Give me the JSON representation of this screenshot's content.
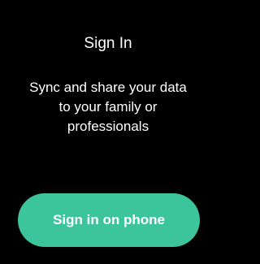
{
  "screen": {
    "title": "Sign In",
    "message_lines": [
      "Sync and share your data",
      "to your family or",
      "professionals"
    ],
    "primary_button_label": "Sign in on phone"
  },
  "colors": {
    "background": "#000000",
    "text": "#ffffff",
    "button": "#3cc59a"
  }
}
